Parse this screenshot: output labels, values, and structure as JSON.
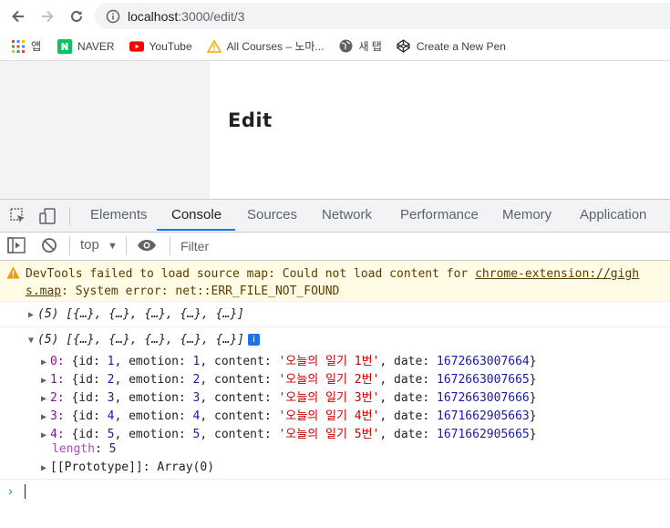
{
  "browser": {
    "url_host": "localhost",
    "url_path": ":3000/edit/3",
    "bookmarks": [
      {
        "label": "앱",
        "icon": "apps-grid-icon"
      },
      {
        "label": "NAVER",
        "icon": "naver-icon"
      },
      {
        "label": "YouTube",
        "icon": "youtube-icon"
      },
      {
        "label": "All Courses – 노마...",
        "icon": "warning-triangle-icon"
      },
      {
        "label": "새 탭",
        "icon": "globe-icon"
      },
      {
        "label": "Create a New Pen",
        "icon": "codepen-icon"
      }
    ]
  },
  "page": {
    "title": "Edit"
  },
  "devtools": {
    "tabs": [
      "Elements",
      "Console",
      "Sources",
      "Network",
      "Performance",
      "Memory",
      "Application"
    ],
    "active_tab": "Console",
    "context": "top",
    "filter_placeholder": "Filter",
    "warning_line1": "DevTools failed to load source map: Could not load content for ",
    "warning_link1": "chrome-extension://gigh",
    "warning_link2": "s.map",
    "warning_line2": ": System error: net::ERR_FILE_NOT_FOUND",
    "log1_summary": "(5) [{…}, {…}, {…}, {…}, {…}]",
    "log2_summary": "(5) [{…}, {…}, {…}, {…}, {…}]",
    "log2_badge": "i",
    "items": [
      {
        "index": "0",
        "id": "1",
        "emotion": "1",
        "content": "'오늘의 일기 1번'",
        "date": "1672663007664"
      },
      {
        "index": "1",
        "id": "2",
        "emotion": "2",
        "content": "'오늘의 일기 2번'",
        "date": "1672663007665"
      },
      {
        "index": "2",
        "id": "3",
        "emotion": "3",
        "content": "'오늘의 일기 3번'",
        "date": "1672663007666"
      },
      {
        "index": "3",
        "id": "4",
        "emotion": "4",
        "content": "'오늘의 일기 4번'",
        "date": "1671662905663"
      },
      {
        "index": "4",
        "id": "5",
        "emotion": "5",
        "content": "'오늘의 일기 5번'",
        "date": "1671662905665"
      }
    ],
    "length_key": "length",
    "length_value": "5",
    "prototype_label": "[[Prototype]]",
    "prototype_value": "Array(0)"
  }
}
